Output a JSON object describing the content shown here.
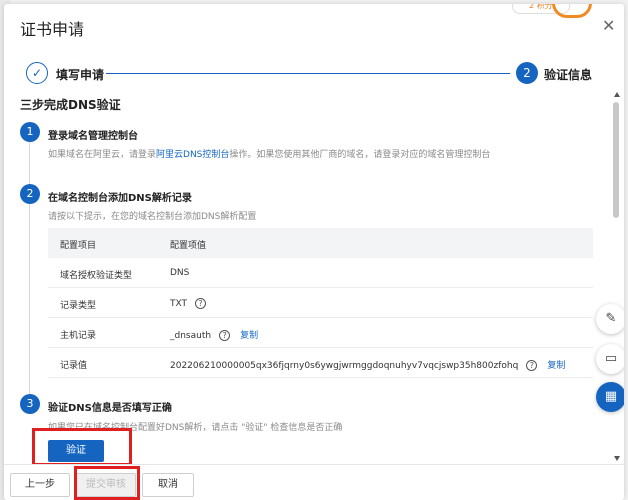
{
  "dialog": {
    "title": "证书申请",
    "close_icon": "✕"
  },
  "badge": {
    "text": "2 积分"
  },
  "steps": [
    {
      "index": "✓",
      "label": "填写申请"
    },
    {
      "index": "2",
      "label": "验证信息"
    }
  ],
  "section": {
    "title": "三步完成DNS验证"
  },
  "step1": {
    "num": "1",
    "title": "登录域名管理控制台",
    "desc_before": "如果域名在阿里云，请登录",
    "desc_link": "阿里云DNS控制台",
    "desc_after": "操作。如果您使用其他厂商的域名，请登录对应的域名管理控制台"
  },
  "step2": {
    "num": "2",
    "title": "在域名控制台添加DNS解析记录",
    "desc": "请按以下提示，在您的域名控制台添加DNS解析配置",
    "table": {
      "headers": [
        "配置项目",
        "配置项值"
      ],
      "rows": [
        {
          "label": "域名授权验证类型",
          "value": "DNS"
        },
        {
          "label": "记录类型",
          "value": "TXT"
        },
        {
          "label": "主机记录",
          "value": "_dnsauth",
          "copy": "复制"
        },
        {
          "label": "记录值",
          "value": "202206210000005qx36fjqrny0s6ywgjwrmggdoqnuhyv7vqcjswp35h800zfohq",
          "copy": "复制"
        }
      ]
    }
  },
  "step3": {
    "num": "3",
    "title": "验证DNS信息是否填写正确",
    "desc": "如果您已在域名控制台配置好DNS解析，请点击 \"验证\" 检查信息是否正确",
    "verify_label": "验证"
  },
  "help_icon": "?",
  "footer": {
    "prev": "上一步",
    "submit": "提交审核",
    "cancel": "取消"
  },
  "float_icons": [
    "pencil-icon",
    "chat-icon",
    "grid-icon"
  ]
}
